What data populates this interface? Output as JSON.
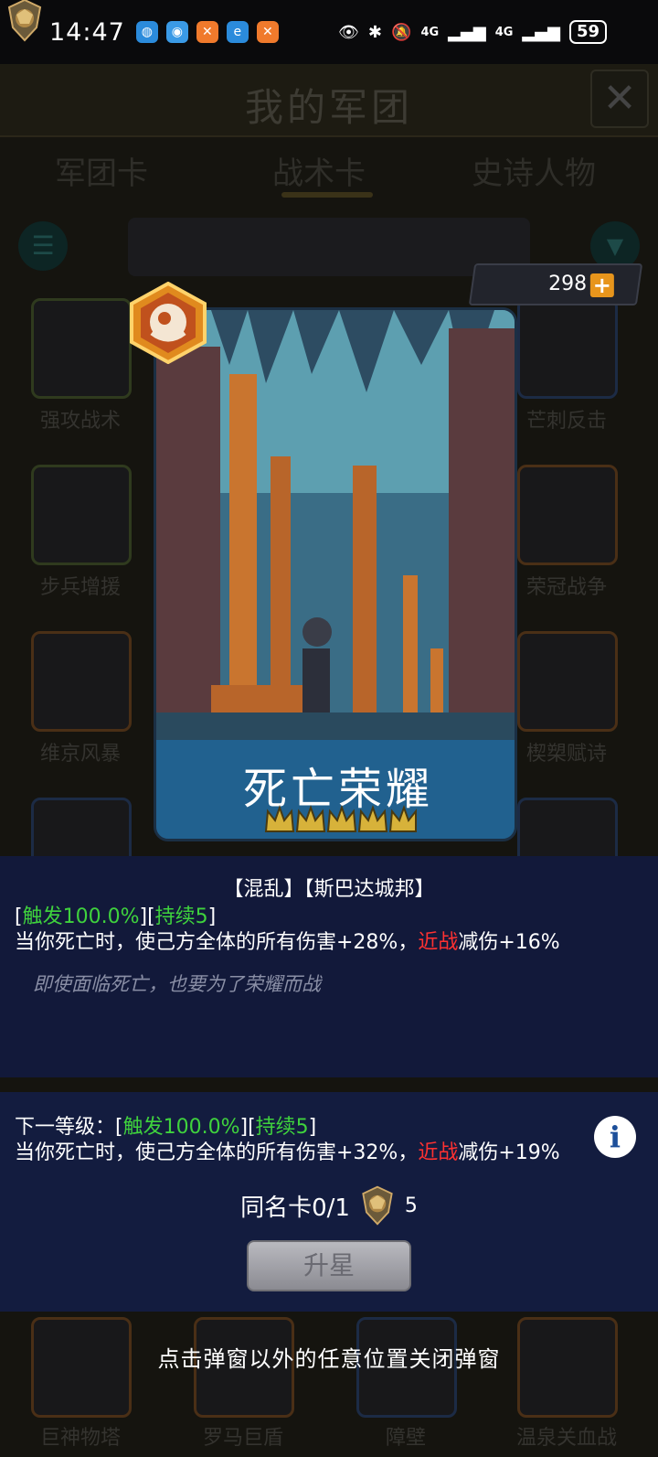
{
  "status_bar": {
    "time": "14:47",
    "apps": [
      {
        "icon": "globe-app-icon",
        "color": "#2b8bdc"
      },
      {
        "icon": "browser-app-icon",
        "color": "#3a9ae6"
      },
      {
        "icon": "orange-app-icon",
        "color": "#f07a2c"
      },
      {
        "icon": "edge-app-icon",
        "color": "#2b8bdc"
      },
      {
        "icon": "orange-app-icon",
        "color": "#f07a2c"
      }
    ],
    "network1": "4G",
    "network2": "4G",
    "battery": "59"
  },
  "background": {
    "title": "我的军团",
    "tabs": [
      "军团卡",
      "战术卡",
      "史诗人物"
    ],
    "card_labels": [
      "强攻战术",
      "芒刺反击",
      "步兵增援",
      "荣冠战争",
      "维京风暴",
      "楔槊赋诗"
    ],
    "bottom_labels": [
      "巨神物塔",
      "罗马巨盾",
      "障壁",
      "温泉关血战"
    ]
  },
  "currency": {
    "value": "298",
    "plus": "+"
  },
  "card": {
    "name": "死亡荣耀",
    "stars": 5
  },
  "description": {
    "faction": "【混乱】【斯巴达城邦】",
    "trigger": {
      "open": "[",
      "trigger_text": "触发100.0%",
      "mid": "][",
      "duration_text": "持续5",
      "close": "]"
    },
    "effect": {
      "part1": "当你死亡时，使己方全体的所有伤害+28%，",
      "keyword": "近战",
      "part2": "减伤+16%"
    },
    "flavor": "即使面临死亡，也要为了荣耀而战"
  },
  "next_level": {
    "label": "下一等级：[",
    "trigger_text": "触发100.0%",
    "mid": "][",
    "duration_text": "持续5",
    "close": "]",
    "effect_part1": "当你死亡时，使己方全体的所有伤害+32%，",
    "keyword": "近战",
    "effect_part2": "减伤+19%",
    "info": "i"
  },
  "duplicate": {
    "label": "同名卡0/1",
    "cost": "5"
  },
  "upgrade_button": "升星",
  "close_hint": "点击弹窗以外的任意位置关闭弹窗",
  "colors": {
    "trigger_green": "#3fd23d",
    "keyword_red": "#ff3131",
    "panel_bg": "#12193a",
    "currency_plus": "#e7951c"
  }
}
